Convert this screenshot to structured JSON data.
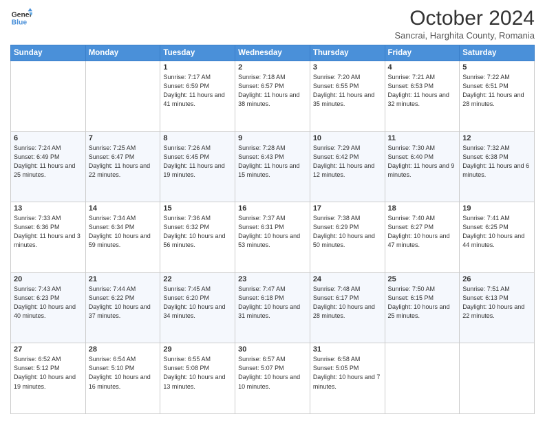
{
  "header": {
    "logo_line1": "General",
    "logo_line2": "Blue",
    "month_title": "October 2024",
    "subtitle": "Sancrai, Harghita County, Romania"
  },
  "days_of_week": [
    "Sunday",
    "Monday",
    "Tuesday",
    "Wednesday",
    "Thursday",
    "Friday",
    "Saturday"
  ],
  "weeks": [
    [
      {
        "day": "",
        "info": ""
      },
      {
        "day": "",
        "info": ""
      },
      {
        "day": "1",
        "info": "Sunrise: 7:17 AM\nSunset: 6:59 PM\nDaylight: 11 hours and 41 minutes."
      },
      {
        "day": "2",
        "info": "Sunrise: 7:18 AM\nSunset: 6:57 PM\nDaylight: 11 hours and 38 minutes."
      },
      {
        "day": "3",
        "info": "Sunrise: 7:20 AM\nSunset: 6:55 PM\nDaylight: 11 hours and 35 minutes."
      },
      {
        "day": "4",
        "info": "Sunrise: 7:21 AM\nSunset: 6:53 PM\nDaylight: 11 hours and 32 minutes."
      },
      {
        "day": "5",
        "info": "Sunrise: 7:22 AM\nSunset: 6:51 PM\nDaylight: 11 hours and 28 minutes."
      }
    ],
    [
      {
        "day": "6",
        "info": "Sunrise: 7:24 AM\nSunset: 6:49 PM\nDaylight: 11 hours and 25 minutes."
      },
      {
        "day": "7",
        "info": "Sunrise: 7:25 AM\nSunset: 6:47 PM\nDaylight: 11 hours and 22 minutes."
      },
      {
        "day": "8",
        "info": "Sunrise: 7:26 AM\nSunset: 6:45 PM\nDaylight: 11 hours and 19 minutes."
      },
      {
        "day": "9",
        "info": "Sunrise: 7:28 AM\nSunset: 6:43 PM\nDaylight: 11 hours and 15 minutes."
      },
      {
        "day": "10",
        "info": "Sunrise: 7:29 AM\nSunset: 6:42 PM\nDaylight: 11 hours and 12 minutes."
      },
      {
        "day": "11",
        "info": "Sunrise: 7:30 AM\nSunset: 6:40 PM\nDaylight: 11 hours and 9 minutes."
      },
      {
        "day": "12",
        "info": "Sunrise: 7:32 AM\nSunset: 6:38 PM\nDaylight: 11 hours and 6 minutes."
      }
    ],
    [
      {
        "day": "13",
        "info": "Sunrise: 7:33 AM\nSunset: 6:36 PM\nDaylight: 11 hours and 3 minutes."
      },
      {
        "day": "14",
        "info": "Sunrise: 7:34 AM\nSunset: 6:34 PM\nDaylight: 10 hours and 59 minutes."
      },
      {
        "day": "15",
        "info": "Sunrise: 7:36 AM\nSunset: 6:32 PM\nDaylight: 10 hours and 56 minutes."
      },
      {
        "day": "16",
        "info": "Sunrise: 7:37 AM\nSunset: 6:31 PM\nDaylight: 10 hours and 53 minutes."
      },
      {
        "day": "17",
        "info": "Sunrise: 7:38 AM\nSunset: 6:29 PM\nDaylight: 10 hours and 50 minutes."
      },
      {
        "day": "18",
        "info": "Sunrise: 7:40 AM\nSunset: 6:27 PM\nDaylight: 10 hours and 47 minutes."
      },
      {
        "day": "19",
        "info": "Sunrise: 7:41 AM\nSunset: 6:25 PM\nDaylight: 10 hours and 44 minutes."
      }
    ],
    [
      {
        "day": "20",
        "info": "Sunrise: 7:43 AM\nSunset: 6:23 PM\nDaylight: 10 hours and 40 minutes."
      },
      {
        "day": "21",
        "info": "Sunrise: 7:44 AM\nSunset: 6:22 PM\nDaylight: 10 hours and 37 minutes."
      },
      {
        "day": "22",
        "info": "Sunrise: 7:45 AM\nSunset: 6:20 PM\nDaylight: 10 hours and 34 minutes."
      },
      {
        "day": "23",
        "info": "Sunrise: 7:47 AM\nSunset: 6:18 PM\nDaylight: 10 hours and 31 minutes."
      },
      {
        "day": "24",
        "info": "Sunrise: 7:48 AM\nSunset: 6:17 PM\nDaylight: 10 hours and 28 minutes."
      },
      {
        "day": "25",
        "info": "Sunrise: 7:50 AM\nSunset: 6:15 PM\nDaylight: 10 hours and 25 minutes."
      },
      {
        "day": "26",
        "info": "Sunrise: 7:51 AM\nSunset: 6:13 PM\nDaylight: 10 hours and 22 minutes."
      }
    ],
    [
      {
        "day": "27",
        "info": "Sunrise: 6:52 AM\nSunset: 5:12 PM\nDaylight: 10 hours and 19 minutes."
      },
      {
        "day": "28",
        "info": "Sunrise: 6:54 AM\nSunset: 5:10 PM\nDaylight: 10 hours and 16 minutes."
      },
      {
        "day": "29",
        "info": "Sunrise: 6:55 AM\nSunset: 5:08 PM\nDaylight: 10 hours and 13 minutes."
      },
      {
        "day": "30",
        "info": "Sunrise: 6:57 AM\nSunset: 5:07 PM\nDaylight: 10 hours and 10 minutes."
      },
      {
        "day": "31",
        "info": "Sunrise: 6:58 AM\nSunset: 5:05 PM\nDaylight: 10 hours and 7 minutes."
      },
      {
        "day": "",
        "info": ""
      },
      {
        "day": "",
        "info": ""
      }
    ]
  ]
}
